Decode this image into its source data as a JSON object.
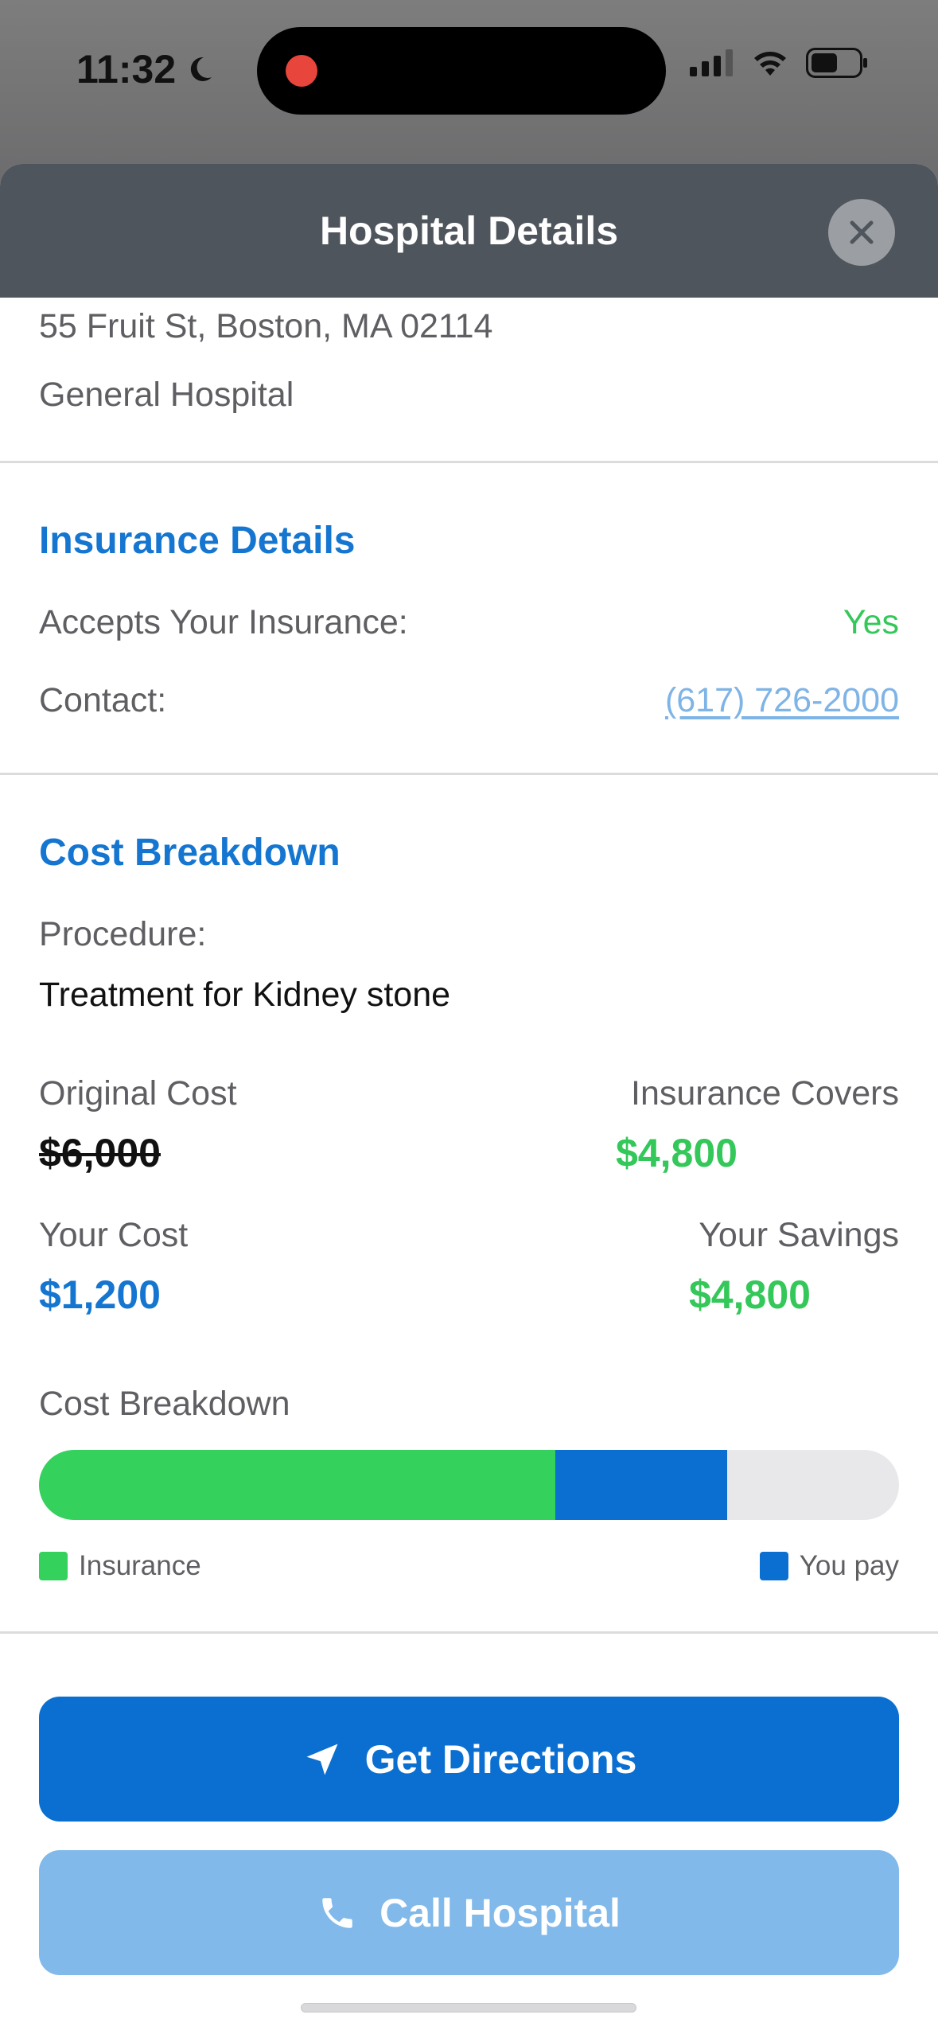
{
  "status_bar": {
    "time": "11:32"
  },
  "header": {
    "title": "Hospital Details"
  },
  "hospital": {
    "address": "55 Fruit St, Boston, MA 02114",
    "type": "General Hospital"
  },
  "insurance": {
    "title": "Insurance Details",
    "accepts_label": "Accepts Your Insurance:",
    "accepts_value": "Yes",
    "contact_label": "Contact:",
    "contact_value": "(617) 726-2000"
  },
  "cost": {
    "title": "Cost Breakdown",
    "procedure_label": "Procedure:",
    "procedure_value": "Treatment for Kidney stone",
    "original_label": "Original Cost",
    "original_value": "$6,000",
    "covers_label": "Insurance Covers",
    "covers_value": "$4,800",
    "your_cost_label": "Your Cost",
    "your_cost_value": "$1,200",
    "savings_label": "Your Savings",
    "savings_value": "$4,800",
    "breakdown_label": "Cost Breakdown",
    "bar_insurance_fraction": 0.6,
    "bar_you_pay_fraction": 0.2,
    "legend_insurance": "Insurance",
    "legend_you_pay": "You pay"
  },
  "actions": {
    "directions_label": "Get Directions",
    "call_label": "Call Hospital"
  },
  "colors": {
    "accent_blue": "#0a6fd0",
    "green": "#34c759",
    "light_blue_button": "#80b9ea",
    "header_bg": "#4f555c"
  }
}
